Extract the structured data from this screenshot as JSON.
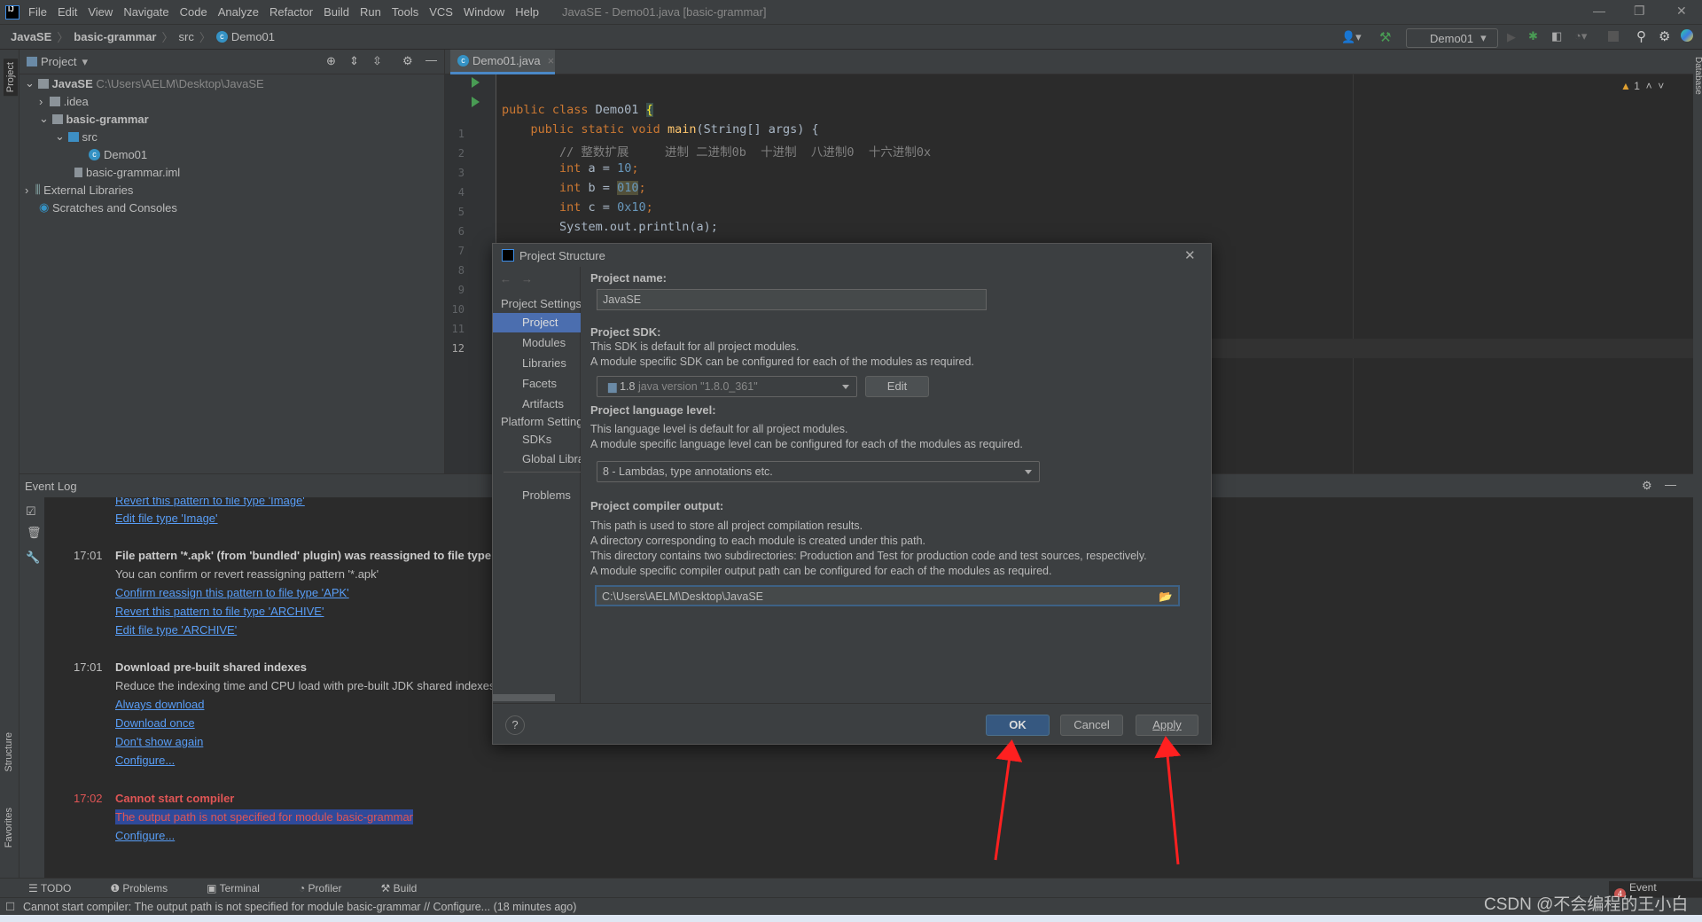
{
  "menubar": {
    "items": [
      "File",
      "Edit",
      "View",
      "Navigate",
      "Code",
      "Analyze",
      "Refactor",
      "Build",
      "Run",
      "Tools",
      "VCS",
      "Window",
      "Help"
    ],
    "window_title": "JavaSE - Demo01.java [basic-grammar]"
  },
  "navbar": {
    "crumbs": [
      "JavaSE",
      "basic-grammar",
      "src",
      "Demo01"
    ],
    "run_config": "Demo01"
  },
  "left_stripe": {
    "project": "Project",
    "structure": "Structure",
    "favorites": "Favorites"
  },
  "right_stripe": {
    "database": "Database"
  },
  "project_panel": {
    "title": "Project",
    "tree": [
      {
        "label": "JavaSE",
        "path": "C:\\Users\\AELM\\Desktop\\JavaSE"
      },
      {
        "label": ".idea"
      },
      {
        "label": "basic-grammar"
      },
      {
        "label": "src"
      },
      {
        "label": "Demo01"
      },
      {
        "label": "basic-grammar.iml"
      },
      {
        "label": "External Libraries"
      },
      {
        "label": "Scratches and Consoles"
      }
    ]
  },
  "editor": {
    "tab": "Demo01.java",
    "warnings": "1",
    "line_numbers": [
      "1",
      "2",
      "3",
      "4",
      "5",
      "6",
      "7",
      "8",
      "9",
      "10",
      "11",
      "12"
    ],
    "lines": {
      "l1a": "public class ",
      "l1b": "Demo01 ",
      "l1c": "{",
      "l2a": "    public static void ",
      "l2b": "main",
      "l2c": "(String[] args) {",
      "l3": "        // 整数扩展     进制 二进制0b  十进制  八进制0  十六进制0x",
      "kw_int": "        int ",
      "l4a": "a = ",
      "l4b": "10",
      "l5a": "b = ",
      "l5b": "010",
      "l6a": "c = ",
      "l6b": "0x10",
      "semi": ";",
      "l7": "        System.out.println(a);"
    }
  },
  "event_log": {
    "title": "Event Log",
    "entries": [
      {
        "time": "",
        "links": [
          "Revert this pattern to file type 'Image'",
          "Edit file type 'Image'"
        ]
      },
      {
        "time": "17:01",
        "title": "File pattern '*.apk' (from 'bundled' plugin) was reassigned to file type 'A",
        "text": "You can confirm or revert reassigning pattern '*.apk'",
        "links": [
          "Confirm reassign this pattern to file type 'APK'",
          "Revert this pattern to file type 'ARCHIVE'",
          "Edit file type 'ARCHIVE'"
        ]
      },
      {
        "time": "17:01",
        "title": "Download pre-built shared indexes",
        "text": "Reduce the indexing time and CPU load with pre-built JDK shared indexes",
        "links": [
          "Always download",
          "Download once",
          "Don't show again",
          "Configure..."
        ]
      },
      {
        "time": "17:02",
        "title": "Cannot start compiler",
        "text": "The output path is not specified for module basic-grammar",
        "links": [
          "Configure..."
        ]
      }
    ]
  },
  "bottom_bar": {
    "tabs": [
      "TODO",
      "Problems",
      "Terminal",
      "Profiler",
      "Build"
    ],
    "event_log": "Event Log",
    "event_count": "4"
  },
  "status_bar": {
    "message": "Cannot start compiler: The output path is not specified for module basic-grammar // Configure... (18 minutes ago)",
    "watermark": "CSDN @不会编程的王小白"
  },
  "dialog": {
    "title": "Project Structure",
    "nav": {
      "project_settings": "Project Settings",
      "items1": [
        "Project",
        "Modules",
        "Libraries",
        "Facets",
        "Artifacts"
      ],
      "platform_settings": "Platform Settings",
      "items2": [
        "SDKs",
        "Global Libraries"
      ],
      "problems": "Problems",
      "selected": "Project"
    },
    "project_name_label": "Project name:",
    "project_name": "JavaSE",
    "sdk_label": "Project SDK:",
    "sdk_desc1": "This SDK is default for all project modules.",
    "sdk_desc2": "A module specific SDK can be configured for each of the modules as required.",
    "sdk_version": "1.8",
    "sdk_detail": "java version \"1.8.0_361\"",
    "edit_button": "Edit",
    "lang_label": "Project language level:",
    "lang_desc1": "This language level is default for all project modules.",
    "lang_desc2": "A module specific language level can be configured for each of the modules as required.",
    "lang_value": "8 - Lambdas, type annotations etc.",
    "output_label": "Project compiler output:",
    "output_desc1": "This path is used to store all project compilation results.",
    "output_desc2": "A directory corresponding to each module is created under this path.",
    "output_desc3": "This directory contains two subdirectories: Production and Test for production code and test sources, respectively.",
    "output_desc4": "A module specific compiler output path can be configured for each of the modules as required.",
    "output_path": "C:\\Users\\AELM\\Desktop\\JavaSE",
    "help": "?",
    "ok": "OK",
    "cancel": "Cancel",
    "apply": "Apply"
  },
  "colors": {
    "accent": "#4a88c7",
    "selection": "#2f65ca",
    "error": "#e05555",
    "link": "#589df6",
    "annotation_arrow": "#ff2020"
  }
}
